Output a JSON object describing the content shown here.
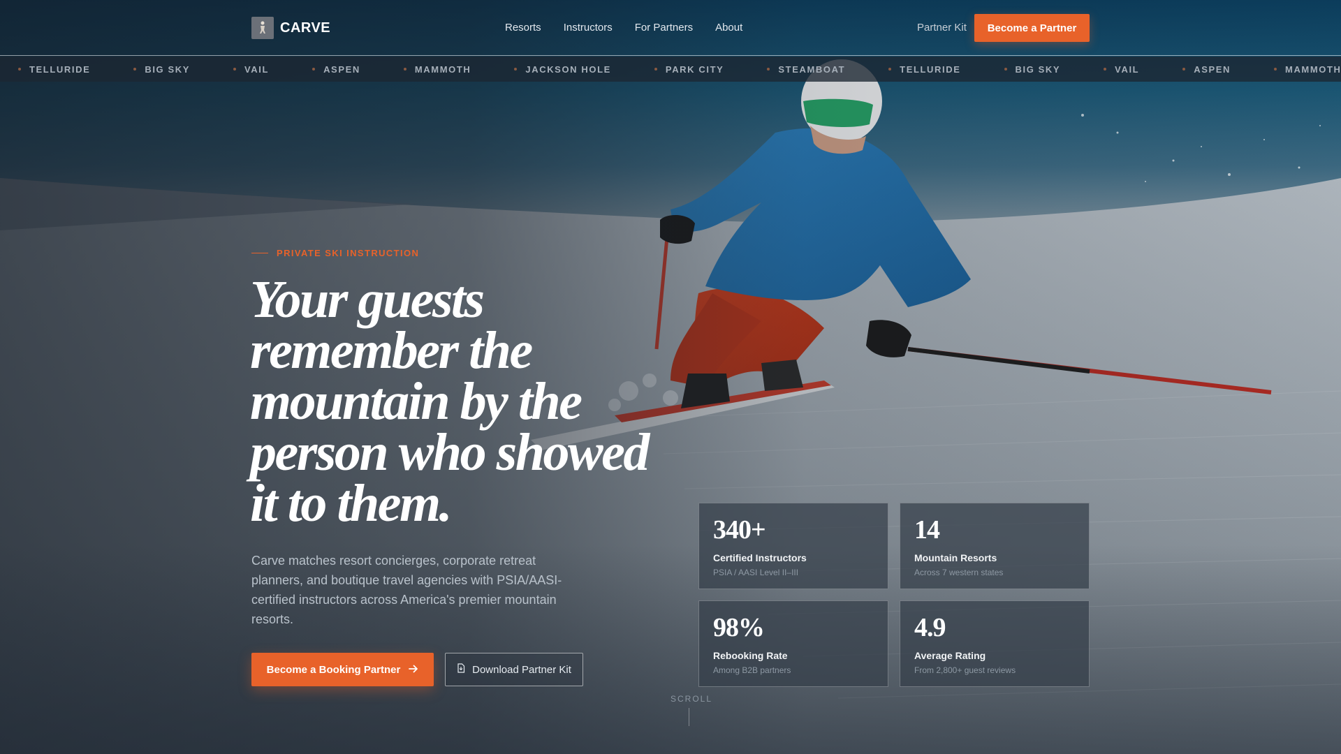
{
  "brand": {
    "name": "CARVE"
  },
  "nav": {
    "items": [
      "Resorts",
      "Instructors",
      "For Partners",
      "About"
    ],
    "partner_kit": "Partner Kit",
    "cta": "Become a Partner"
  },
  "ticker": {
    "items": [
      "TELLURIDE",
      "BIG SKY",
      "VAIL",
      "ASPEN",
      "MAMMOTH",
      "JACKSON HOLE",
      "PARK CITY",
      "STEAMBOAT",
      "TELLURIDE",
      "BIG SKY",
      "VAIL",
      "ASPEN",
      "MAMMOTH"
    ]
  },
  "hero": {
    "eyebrow": "PRIVATE SKI INSTRUCTION",
    "headline": "Your guests remember the mountain by the person who showed it to them.",
    "subcopy": "Carve matches resort concierges, corporate retreat planners, and boutique travel agencies with PSIA/AASI-certified instructors across America's premier mountain resorts.",
    "cta_primary": "Become a Booking Partner",
    "cta_secondary": "Download Partner Kit"
  },
  "stats": [
    {
      "value": "340+",
      "label": "Certified Instructors",
      "sub": "PSIA / AASI Level II–III"
    },
    {
      "value": "14",
      "label": "Mountain Resorts",
      "sub": "Across 7 western states"
    },
    {
      "value": "98%",
      "label": "Rebooking Rate",
      "sub": "Among B2B partners"
    },
    {
      "value": "4.9",
      "label": "Average Rating",
      "sub": "From 2,800+ guest reviews"
    }
  ],
  "scroll": {
    "label": "SCROLL"
  },
  "colors": {
    "accent": "#e8622a",
    "sky": "#0b3e5e",
    "card": "#343e4a"
  },
  "icons": {
    "logo": "skier-icon",
    "cta_arrow": "arrow-right-icon",
    "download": "document-icon"
  }
}
